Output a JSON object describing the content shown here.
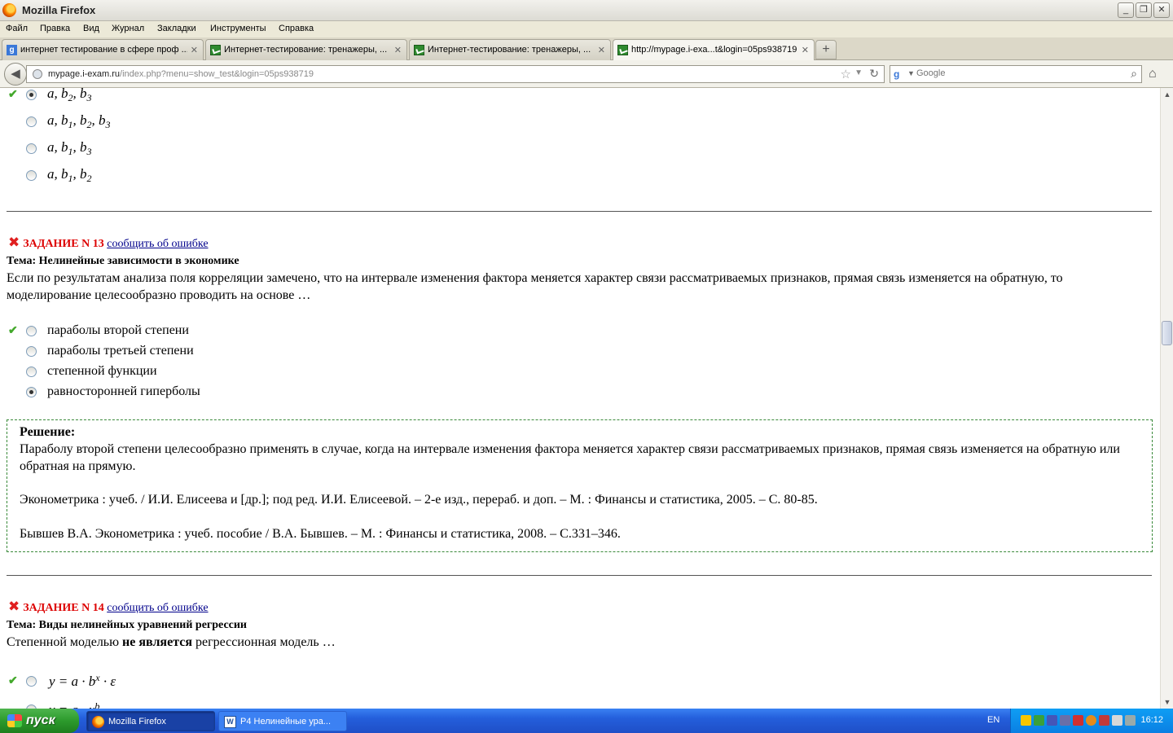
{
  "window": {
    "title": "Mozilla Firefox"
  },
  "menu": [
    "Файл",
    "Правка",
    "Вид",
    "Журнал",
    "Закладки",
    "Инструменты",
    "Справка"
  ],
  "tabs": [
    {
      "label": "интернет тестирование в сфере проф ...",
      "icon": "google-icon"
    },
    {
      "label": "Интернет-тестирование: тренажеры, ...",
      "icon": "site-icon"
    },
    {
      "label": "Интернет-тестирование: тренажеры, ...",
      "icon": "site-icon"
    },
    {
      "label": "http://mypage.i-exa...t&login=05ps938719",
      "icon": "site-icon"
    }
  ],
  "nav": {
    "url_host": "mypage.i-exam.ru",
    "url_path": "/index.php?menu=show_test&login=05ps938719",
    "search_placeholder": "Google"
  },
  "task12_options": [
    {
      "base": "a, b",
      "subs": [
        "2",
        "3"
      ],
      "checked": true,
      "correct": true
    },
    {
      "base": "a, b",
      "subs": [
        "1",
        "2",
        "3"
      ],
      "checked": false,
      "correct": false
    },
    {
      "base": "a,  b",
      "subs": [
        "1",
        "3"
      ],
      "checked": false,
      "correct": false
    },
    {
      "base": "a,  b",
      "subs": [
        "1",
        "2"
      ],
      "checked": false,
      "correct": false
    }
  ],
  "task13": {
    "title": "ЗАДАНИЕ N 13",
    "report_link": "сообщить об ошибке",
    "topic": "Тема: Нелинейные зависимости в экономике",
    "question": "Если по результатам анализа поля корреляции замечено, что на интервале изменения фактора меняется характер связи рассматриваемых признаков, прямая связь изменяется на обратную, то моделирование целесообразно проводить на основе …",
    "options": [
      {
        "label": "параболы второй степени",
        "checked": false,
        "correct": true
      },
      {
        "label": "параболы третьей степени",
        "checked": false,
        "correct": false
      },
      {
        "label": "степенной функции",
        "checked": false,
        "correct": false
      },
      {
        "label": "равносторонней гиперболы",
        "checked": true,
        "correct": false
      }
    ],
    "solution": {
      "title": "Решение:",
      "text": "Параболу второй степени целесообразно применять в случае, когда на интервале изменения фактора меняется характер связи рассматриваемых признаков, прямая связь изменяется на обратную или обратная на прямую.",
      "ref1": "Эконометрика : учеб. / И.И. Елисеева и [др.]; под ред. И.И. Елисеевой. – 2-е изд., перераб. и доп. – М. : Финансы и статистика, 2005. – С. 80-85.",
      "ref2": "Бывшев В.А. Эконометрика : учеб. пособие / В.А. Бывшев. –  М. : Финансы и статистика, 2008. – С.331–346."
    }
  },
  "task14": {
    "title": "ЗАДАНИЕ N 14",
    "report_link": "сообщить об ошибке",
    "topic": "Тема: Виды нелинейных уравнений регрессии",
    "question_pre": "Степенной моделью",
    "question_bold": "не является",
    "question_post": "регрессионная модель …",
    "option1": "y = a · b",
    "option1_sup": "x",
    "option1_tail": " · ε",
    "option2_partial": "y = a · x",
    "option2_sup": "b"
  },
  "taskbar": {
    "start": "пуск",
    "items": [
      "Mozilla Firefox",
      "P4 Нелинейные ура..."
    ],
    "lang": "EN",
    "clock": "16:12"
  }
}
